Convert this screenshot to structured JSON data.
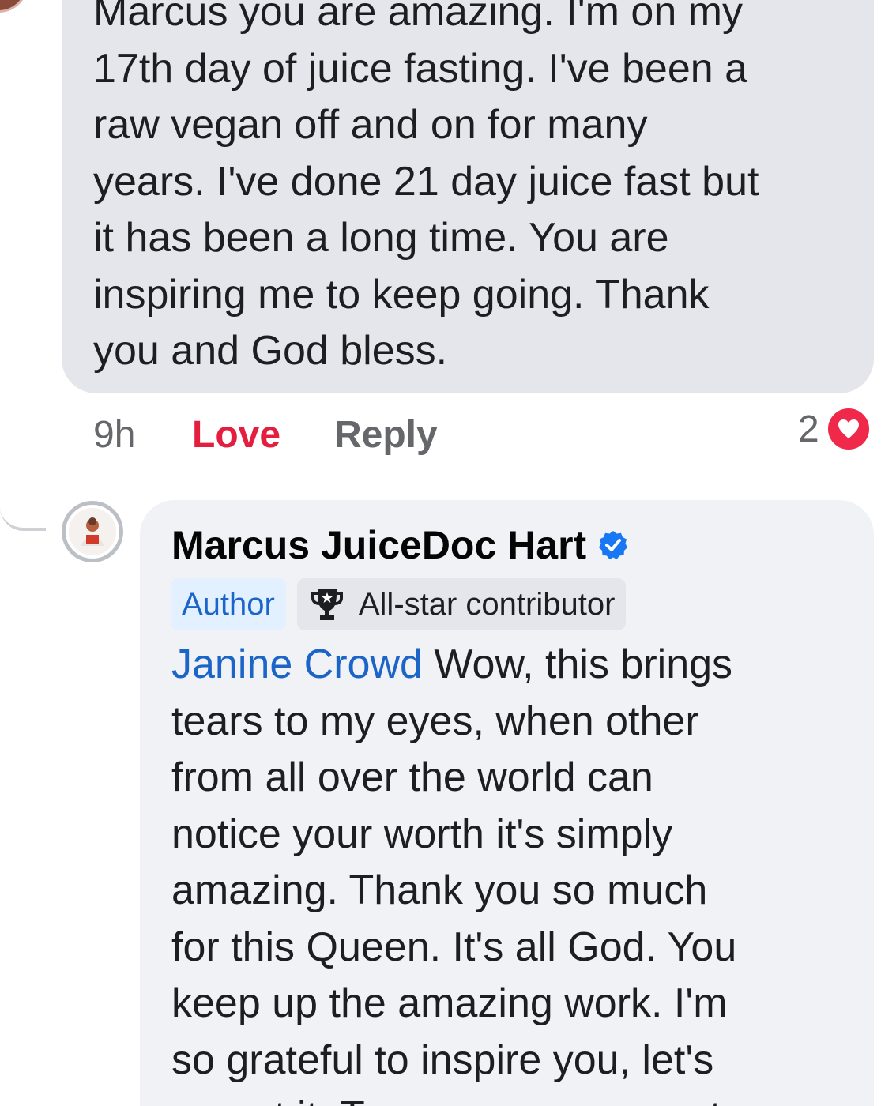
{
  "comment": {
    "text": "Marcus you are amazing.  I'm on my\n17th day of juice fasting.  I've been a\nraw vegan off and on for many\nyears.  I've done 21 day juice fast but\nit has been a long time. You are\ninspiring me to keep going. Thank\nyou and God bless.",
    "time": "9h",
    "love_label": "Love",
    "reply_label": "Reply",
    "reaction_count": "2",
    "reaction_icon": "heart-icon",
    "reaction_color": "#f0284a"
  },
  "reply": {
    "author_name": "Marcus JuiceDoc Hart",
    "verified_icon": "verified-badge-icon",
    "badges": {
      "author": "Author",
      "allstar": "All-star contributor",
      "allstar_icon": "trophy-icon"
    },
    "mention": "Janine Crowd",
    "text": " Wow, this brings\ntears to my eyes, when other\nfrom all over the world can\nnotice your worth it's simply\namazing.  Thank you so much\nfor this Queen. It's all God. You\nkeep up the amazing work. I'm\nso grateful to inspire you,  let's\ngo get it. Tag me once you get"
  },
  "colors": {
    "love": "#e41e3f",
    "link": "#1b65c9",
    "bubble": "#e4e6eb",
    "reply_bubble": "#f0f2f5"
  }
}
